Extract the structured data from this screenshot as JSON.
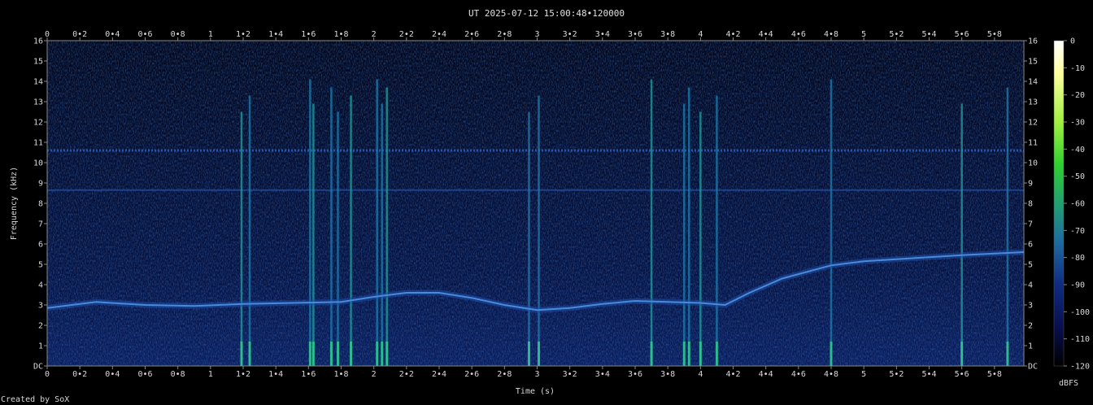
{
  "chart_data": {
    "type": "heatmap",
    "title": "UT 2025-07-12 15:00:48•120000",
    "xlabel": "Time (s)",
    "ylabel": "Frequency (kHz)",
    "xlim": [
      0,
      5.98
    ],
    "ylim": [
      0,
      16
    ],
    "x_ticks": [
      "0",
      "0•2",
      "0•4",
      "0•6",
      "0•8",
      "1",
      "1•2",
      "1•4",
      "1•6",
      "1•8",
      "2",
      "2•2",
      "2•4",
      "2•6",
      "2•8",
      "3",
      "3•2",
      "3•4",
      "3•6",
      "3•8",
      "4",
      "4•2",
      "4•4",
      "4•6",
      "4•8",
      "5",
      "5•2",
      "5•4",
      "5•6",
      "5•8"
    ],
    "y_ticks": [
      "DC",
      "1",
      "2",
      "3",
      "4",
      "5",
      "6",
      "7",
      "8",
      "9",
      "10",
      "11",
      "12",
      "13",
      "14",
      "15",
      "16"
    ],
    "colorbar": {
      "label": "dBFS",
      "ticks": [
        "0",
        "-10",
        "-20",
        "-30",
        "-40",
        "-50",
        "-60",
        "-70",
        "-80",
        "-90",
        "-100",
        "-110",
        "-120"
      ],
      "range": [
        -120,
        0
      ],
      "colors": [
        "#000000",
        "#0a0f50",
        "#0f2c80",
        "#1e6aa0",
        "#22a070",
        "#30d030",
        "#a0f040",
        "#ffffa0",
        "#ffffff"
      ]
    },
    "tone_curve": {
      "name": "tone",
      "time": [
        0,
        0.3,
        0.6,
        0.9,
        1.2,
        1.5,
        1.8,
        2.0,
        2.2,
        2.4,
        2.6,
        2.8,
        3.0,
        3.2,
        3.4,
        3.6,
        3.8,
        4.0,
        4.15,
        4.3,
        4.5,
        4.8,
        5.0,
        5.3,
        5.6,
        5.98
      ],
      "freq_khz": [
        2.85,
        3.15,
        3.0,
        2.95,
        3.05,
        3.1,
        3.15,
        3.4,
        3.6,
        3.6,
        3.35,
        3.0,
        2.75,
        2.85,
        3.05,
        3.2,
        3.15,
        3.1,
        3.0,
        3.6,
        4.3,
        4.95,
        5.15,
        5.3,
        5.45,
        5.6
      ]
    },
    "horizontal_lines_khz": [
      10.6,
      8.65
    ],
    "impulses_s": [
      1.19,
      1.24,
      1.61,
      1.63,
      1.74,
      1.78,
      1.86,
      2.02,
      2.05,
      2.08,
      2.95,
      3.01,
      3.7,
      3.9,
      3.93,
      4.0,
      4.1,
      4.8,
      5.6,
      5.88
    ]
  },
  "footer": {
    "credit": "Created by SoX"
  },
  "colors": {
    "background": "#000000",
    "text": "#d8d8d8"
  }
}
